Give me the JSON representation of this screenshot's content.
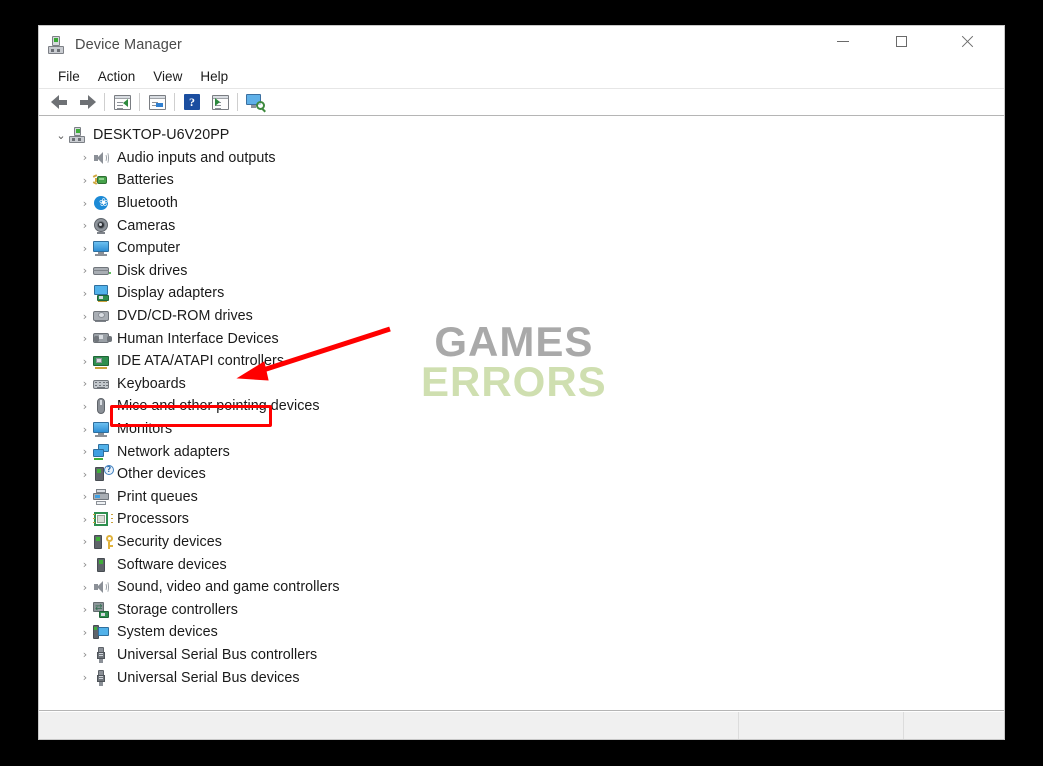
{
  "window": {
    "title": "Device Manager",
    "title_icon": "computer-icon",
    "controls": {
      "minimize": "minimize-icon",
      "maximize": "maximize-icon",
      "close": "close-icon"
    }
  },
  "menubar": {
    "items": [
      {
        "label": "File"
      },
      {
        "label": "Action"
      },
      {
        "label": "View"
      },
      {
        "label": "Help"
      }
    ]
  },
  "toolbar": {
    "buttons": [
      {
        "name": "back-button",
        "icon": "arrow-left-icon",
        "tooltip": "Back"
      },
      {
        "name": "forward-button",
        "icon": "arrow-right-icon",
        "tooltip": "Forward"
      },
      {
        "name": "show-hide-console-tree-button",
        "icon": "console-tree-icon",
        "tooltip": "Show/Hide Console Tree"
      },
      {
        "name": "properties-button",
        "icon": "properties-icon",
        "tooltip": "Properties"
      },
      {
        "name": "help-button",
        "icon": "help-icon",
        "tooltip": "Help"
      },
      {
        "name": "update-driver-button",
        "icon": "update-driver-icon",
        "tooltip": "Update driver"
      },
      {
        "name": "scan-hardware-changes-button",
        "icon": "scan-monitor-icon",
        "tooltip": "Scan for hardware changes"
      }
    ]
  },
  "tree": {
    "root": {
      "label": "DESKTOP-U6V20PP",
      "icon": "computer-icon",
      "expanded": true,
      "chevron": "⌄"
    },
    "chevron_collapsed": "›",
    "nodes": [
      {
        "label": "Audio inputs and outputs",
        "icon": "speaker-icon",
        "key": "audio"
      },
      {
        "label": "Batteries",
        "icon": "battery-icon",
        "key": "battery"
      },
      {
        "label": "Bluetooth",
        "icon": "bluetooth-icon",
        "key": "bluetooth"
      },
      {
        "label": "Cameras",
        "icon": "camera-icon",
        "key": "camera"
      },
      {
        "label": "Computer",
        "icon": "monitor-icon",
        "key": "monitor"
      },
      {
        "label": "Disk drives",
        "icon": "disk-drive-icon",
        "key": "disk"
      },
      {
        "label": "Display adapters",
        "icon": "display-adapter-icon",
        "key": "display",
        "highlighted": true
      },
      {
        "label": "DVD/CD-ROM drives",
        "icon": "dvd-drive-icon",
        "key": "dvd"
      },
      {
        "label": "Human Interface Devices",
        "icon": "hid-icon",
        "key": "hid"
      },
      {
        "label": "IDE ATA/ATAPI controllers",
        "icon": "controller-card-icon",
        "key": "ide"
      },
      {
        "label": "Keyboards",
        "icon": "keyboard-icon",
        "key": "keyboard"
      },
      {
        "label": "Mice and other pointing devices",
        "icon": "mouse-icon",
        "key": "mouse"
      },
      {
        "label": "Monitors",
        "icon": "monitor-icon",
        "key": "monitor"
      },
      {
        "label": "Network adapters",
        "icon": "network-adapter-icon",
        "key": "network"
      },
      {
        "label": "Other devices",
        "icon": "unknown-device-icon",
        "key": "other"
      },
      {
        "label": "Print queues",
        "icon": "printer-icon",
        "key": "printer"
      },
      {
        "label": "Processors",
        "icon": "processor-icon",
        "key": "cpu"
      },
      {
        "label": "Security devices",
        "icon": "security-key-icon",
        "key": "security"
      },
      {
        "label": "Software devices",
        "icon": "software-device-icon",
        "key": "software"
      },
      {
        "label": "Sound, video and game controllers",
        "icon": "speaker-icon",
        "key": "audio"
      },
      {
        "label": "Storage controllers",
        "icon": "storage-controller-icon",
        "key": "storage"
      },
      {
        "label": "System devices",
        "icon": "system-device-icon",
        "key": "system"
      },
      {
        "label": "Universal Serial Bus controllers",
        "icon": "usb-icon",
        "key": "usb"
      },
      {
        "label": "Universal Serial Bus devices",
        "icon": "usb-icon",
        "key": "usb"
      }
    ]
  },
  "annotations": {
    "highlight_color": "#ff0000",
    "highlight_target": "Display adapters",
    "arrow_color": "#ff0000"
  },
  "watermark": {
    "line1": "GAMES",
    "line2": "ERRORS",
    "color1": "#a9a9a9",
    "color2": "#cfdfb0"
  },
  "statusbar": {
    "main_text": "",
    "pane2_text": "",
    "pane3_text": ""
  }
}
